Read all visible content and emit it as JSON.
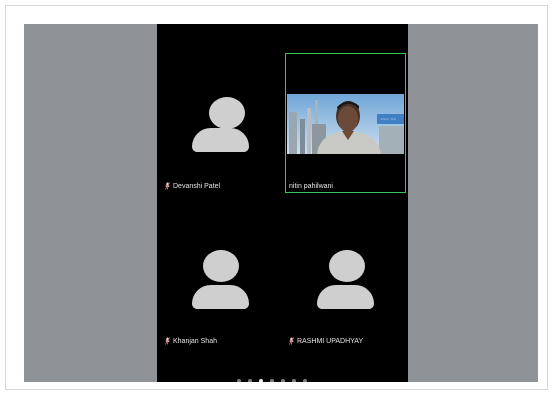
{
  "status_text": "",
  "participants": [
    {
      "name": "Devanshi Patel",
      "muted": true,
      "video": false
    },
    {
      "name": "nitin pahilwani",
      "muted": false,
      "video": true,
      "active_speaker": true
    },
    {
      "name": "Khanjan Shah",
      "muted": true,
      "video": false
    },
    {
      "name": "RASHMI UPADHYAY",
      "muted": true,
      "video": false
    }
  ],
  "pagination": {
    "total_pages": 7,
    "current_page": 3
  },
  "colors": {
    "active_speaker_border": "#35c45a",
    "background": "#000000",
    "side_panels": "#8f9297"
  }
}
